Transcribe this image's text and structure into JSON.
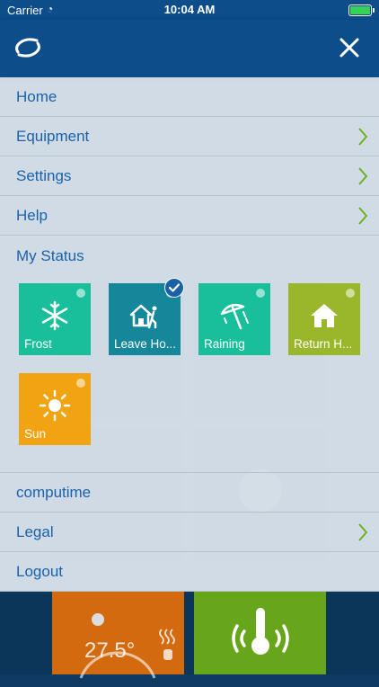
{
  "status_bar": {
    "carrier": "Carrier",
    "time": "10:04 AM"
  },
  "menu": {
    "items": [
      {
        "label": "Home"
      },
      {
        "label": "Equipment"
      },
      {
        "label": "Settings"
      },
      {
        "label": "Help"
      }
    ],
    "status_title": "My Status",
    "status_tiles": [
      {
        "label": "Frost",
        "color": "#19bf9a",
        "icon": "snowflake-icon"
      },
      {
        "label": "Leave Ho...",
        "color": "#14879b",
        "icon": "leave-home-icon",
        "selected": true
      },
      {
        "label": "Raining",
        "color": "#19bf9a",
        "icon": "umbrella-rain-icon"
      },
      {
        "label": "Return H...",
        "color": "#9ab62a",
        "icon": "return-home-icon"
      },
      {
        "label": "Sun",
        "color": "#f2a312",
        "icon": "sun-icon"
      }
    ],
    "bottom_items": [
      {
        "label": "computime"
      },
      {
        "label": "Legal"
      },
      {
        "label": "Logout"
      }
    ]
  },
  "background_tiles": {
    "temperature": "27.5°"
  },
  "colors": {
    "header": "#0d4d8a",
    "menu_text": "#1a62a8",
    "accent_orange": "#d46a10",
    "accent_green": "#67a61a"
  }
}
